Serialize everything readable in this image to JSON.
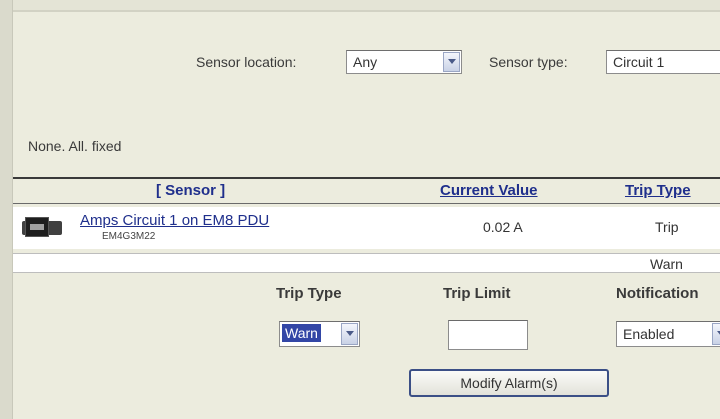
{
  "filters": {
    "sensor_location_label": "Sensor location:",
    "sensor_location_value": "Any",
    "sensor_type_label": "Sensor type:",
    "sensor_type_value": "Circuit 1"
  },
  "status_text": "None. All. fixed",
  "table": {
    "headers": {
      "sensor": "[ Sensor ]",
      "current_value": "Current Value",
      "trip_type": "Trip Type"
    },
    "rows": [
      {
        "sensor_name": "Amps Circuit 1 on EM8 PDU",
        "sensor_id": "EM4G3M22",
        "current_value": "0.02 A",
        "trip_types": [
          "Trip",
          "Warn"
        ]
      }
    ]
  },
  "bottom": {
    "trip_type_label": "Trip Type",
    "trip_type_value": "Warn",
    "trip_limit_label": "Trip Limit",
    "trip_limit_value": "",
    "notification_label": "Notification",
    "notification_value": "Enabled",
    "modify_button": "Modify Alarm(s)"
  },
  "colors": {
    "background": "#ececde",
    "link": "#1f2f8c",
    "button_border": "#3b4f86",
    "selection": "#3246a6"
  }
}
